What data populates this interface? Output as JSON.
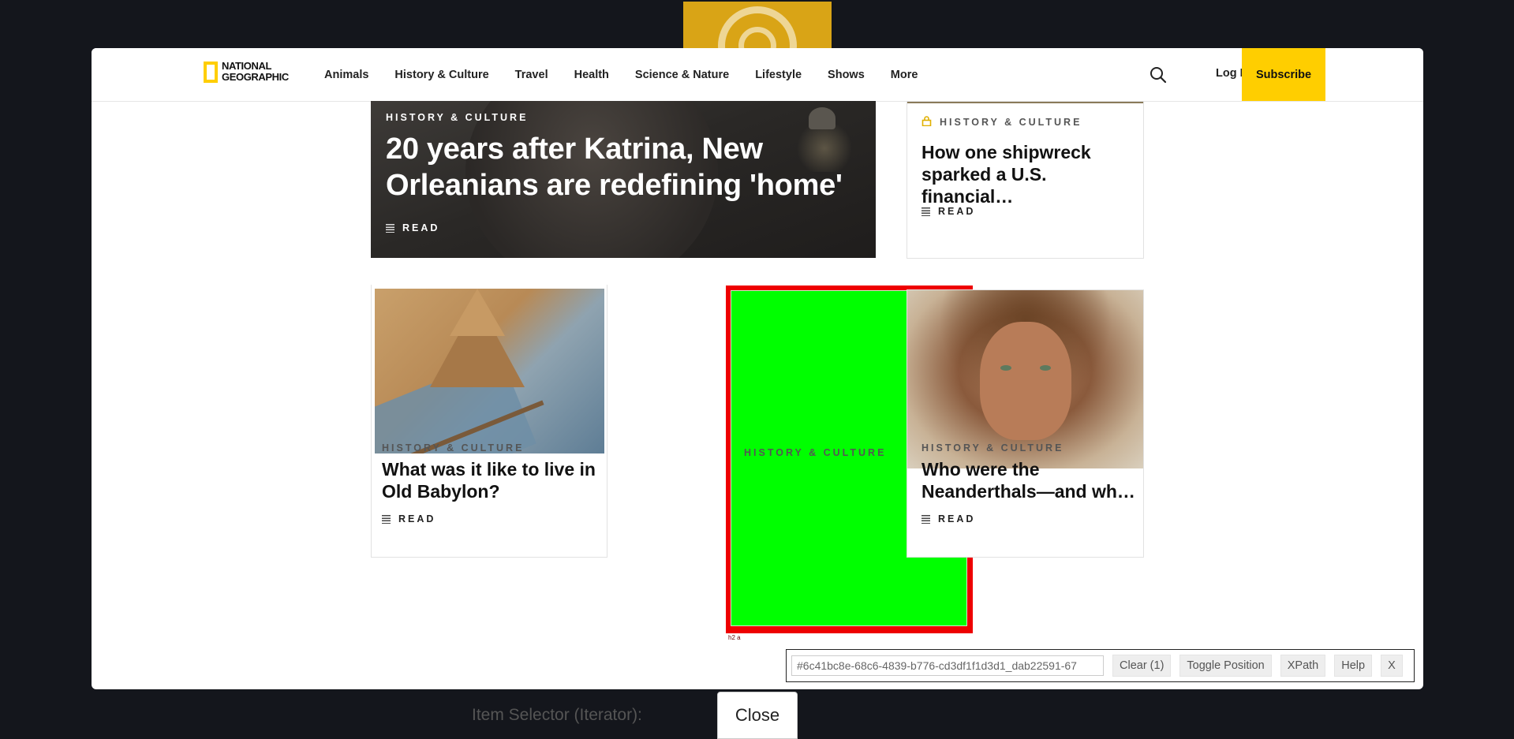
{
  "brand": {
    "name": "NATIONAL\nGEOGRAPHIC",
    "accent": "#ffce00"
  },
  "nav": {
    "items": [
      "Animals",
      "History & Culture",
      "Travel",
      "Health",
      "Science & Nature",
      "Lifestyle",
      "Shows",
      "More"
    ],
    "search_icon": "search-icon",
    "login": "Log In",
    "subscribe": "Subscribe"
  },
  "hero": {
    "category": "HISTORY & CULTURE",
    "title": "20 years after Katrina, New Orleanians are redefining 'home'",
    "read": "READ"
  },
  "cards": [
    {
      "category": "HISTORY & CULTURE",
      "title": "How one shipwreck sparked a U.S. financial…",
      "read": "READ",
      "locked": true,
      "lock_icon": "lock-icon"
    },
    {
      "category": "HISTORY & CULTURE",
      "title": "What was it like to live in Old Babylon?",
      "read": "READ"
    },
    {
      "category": "HISTORY & CULTURE",
      "tag": "h2 a"
    },
    {
      "category": "HISTORY & CULTURE",
      "title": "Who were the Neanderthals—and wh…",
      "read": "READ"
    }
  ],
  "selector_tool": {
    "selector_value": "#6c41bc8e-68c6-4839-b776-cd3df1f1d3d1_dab22591-67",
    "buttons": [
      "Clear (1)",
      "Toggle Position",
      "XPath",
      "Help",
      "X"
    ]
  },
  "footer": {
    "iterator_label": "Item Selector (Iterator):",
    "close": "Close"
  },
  "colors": {
    "highlight_fill": "#00ff00",
    "highlight_border": "#ee0000",
    "subscribe_bg": "#ffce00"
  }
}
